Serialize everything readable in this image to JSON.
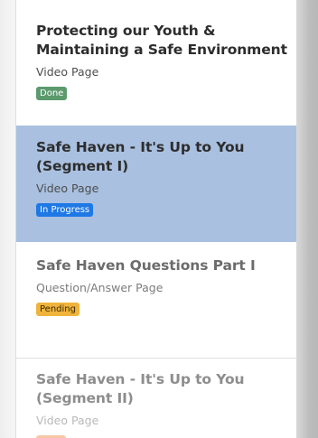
{
  "lesson_list": {
    "items": [
      {
        "title_line1": "Protecting our Youth &",
        "title_line2": "Maintaining a Safe Environment",
        "type": "Video Page",
        "status": "Done"
      },
      {
        "title_line1": "Safe Haven - It's Up to You",
        "title_line2": "(Segment I)",
        "type": "Video Page",
        "status": "In Progress"
      },
      {
        "title_line1": "Safe Haven Questions Part I",
        "title_line2": "",
        "type": "Question/Answer Page",
        "status": "Pending"
      },
      {
        "title_line1": "Safe Haven - It's Up to You",
        "title_line2": "(Segment II)",
        "type": "Video Page",
        "status": ""
      }
    ]
  },
  "colors": {
    "active_background": "#a9c0e0",
    "done": "#5c9a6e",
    "in_progress": "#1e78e6",
    "pending": "#f0b43c"
  }
}
